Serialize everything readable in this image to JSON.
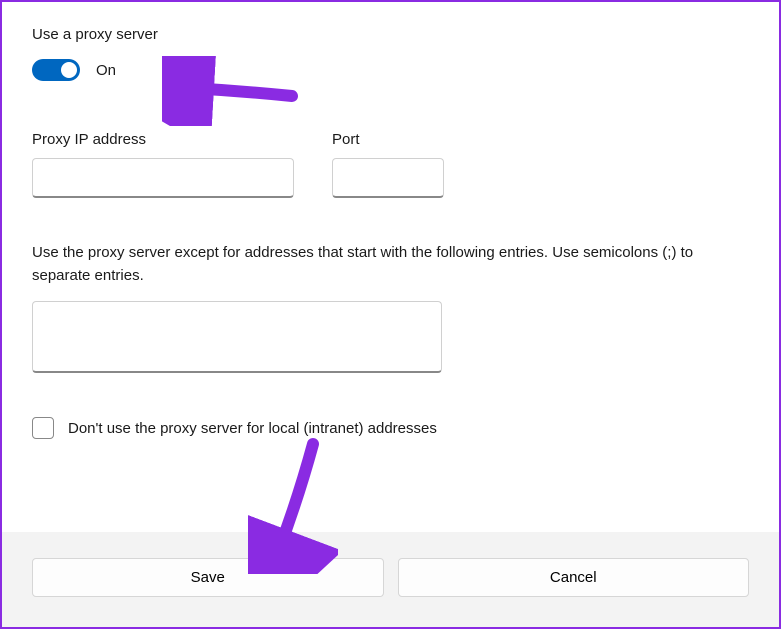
{
  "section": {
    "title": "Use a proxy server"
  },
  "toggle": {
    "state_label": "On",
    "is_on": true
  },
  "fields": {
    "ip_label": "Proxy IP address",
    "ip_value": "",
    "port_label": "Port",
    "port_value": ""
  },
  "exceptions": {
    "label": "Use the proxy server except for addresses that start with the following entries. Use semicolons (;) to separate entries.",
    "value": ""
  },
  "local": {
    "checkbox_label": "Don't use the proxy server for local (intranet) addresses",
    "checked": false
  },
  "footer": {
    "save_label": "Save",
    "cancel_label": "Cancel"
  },
  "annotations": {
    "arrow_color": "#8a2be2"
  }
}
